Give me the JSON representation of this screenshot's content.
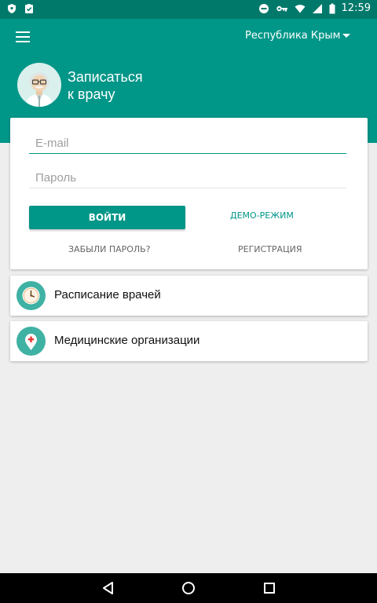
{
  "status_bar": {
    "time": "12:59",
    "left_icons": [
      "shield-icon",
      "clipboard-check-icon"
    ],
    "right_icons": [
      "do-not-disturb-icon",
      "vpn-key-icon",
      "wifi-icon",
      "signal-icon",
      "battery-icon"
    ]
  },
  "app_bar": {
    "menu_icon": "menu-icon",
    "region": "Республика Крым",
    "title_line1": "Записаться",
    "title_line2": "к врачу",
    "accent": "#009688",
    "status_color": "#00796b"
  },
  "login": {
    "email_placeholder": "E-mail",
    "email_value": "",
    "password_placeholder": "Пароль",
    "password_value": "",
    "login_button": "ВОЙТИ",
    "demo_button": "ДЕМО-РЕЖИМ",
    "forgot_link": "ЗАБЫЛИ ПАРОЛЬ?",
    "register_link": "РЕГИСТРАЦИЯ"
  },
  "menu": {
    "items": [
      {
        "label": "Расписание врачей",
        "icon": "clock-icon"
      },
      {
        "label": "Медицинские организации",
        "icon": "map-pin-icon"
      }
    ]
  },
  "nav": {
    "icons": [
      "back-icon",
      "home-icon",
      "recents-icon"
    ]
  }
}
